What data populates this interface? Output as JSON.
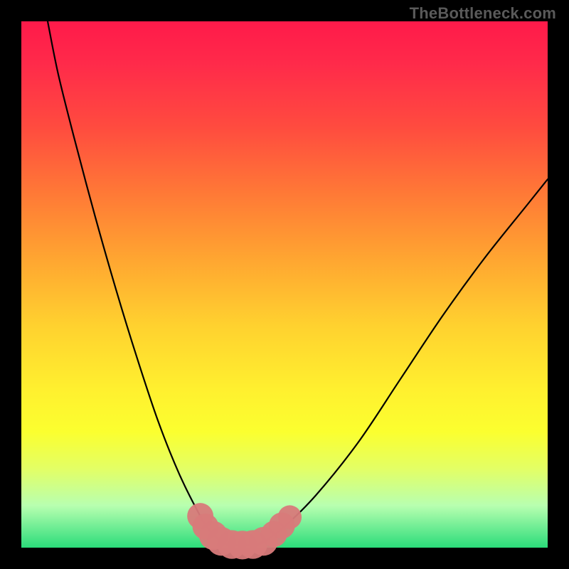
{
  "watermark": "TheBottleneck.com",
  "chart_data": {
    "type": "line",
    "title": "",
    "xlabel": "",
    "ylabel": "",
    "xlim": [
      0,
      100
    ],
    "ylim": [
      0,
      100
    ],
    "grid": false,
    "legend": false,
    "series": [
      {
        "name": "left-curve",
        "x": [
          5,
          7,
          10,
          14,
          18,
          22,
          26,
          30,
          34,
          36,
          38
        ],
        "values": [
          100,
          90,
          78,
          63,
          49,
          36,
          24,
          14,
          6,
          3,
          1
        ]
      },
      {
        "name": "right-curve",
        "x": [
          46,
          50,
          56,
          64,
          72,
          80,
          88,
          96,
          100
        ],
        "values": [
          1,
          4,
          10,
          20,
          32,
          44,
          55,
          65,
          70
        ]
      },
      {
        "name": "valley-floor",
        "x": [
          38,
          40,
          42,
          44,
          46
        ],
        "values": [
          1,
          0.5,
          0.5,
          0.5,
          1
        ]
      }
    ],
    "markers": {
      "name": "salmon-beads",
      "color": "#d87a7a",
      "points": [
        {
          "x": 34,
          "y": 6,
          "r": 1.4
        },
        {
          "x": 35,
          "y": 4,
          "r": 1.4
        },
        {
          "x": 36.5,
          "y": 2.3,
          "r": 1.6
        },
        {
          "x": 38,
          "y": 1.2,
          "r": 1.6
        },
        {
          "x": 40,
          "y": 0.6,
          "r": 1.6
        },
        {
          "x": 42,
          "y": 0.5,
          "r": 1.6
        },
        {
          "x": 44,
          "y": 0.6,
          "r": 1.6
        },
        {
          "x": 46,
          "y": 1.2,
          "r": 1.6
        },
        {
          "x": 48,
          "y": 2.6,
          "r": 1.4
        },
        {
          "x": 49.5,
          "y": 4.2,
          "r": 1.4
        },
        {
          "x": 51,
          "y": 5.8,
          "r": 1.2
        }
      ]
    }
  }
}
